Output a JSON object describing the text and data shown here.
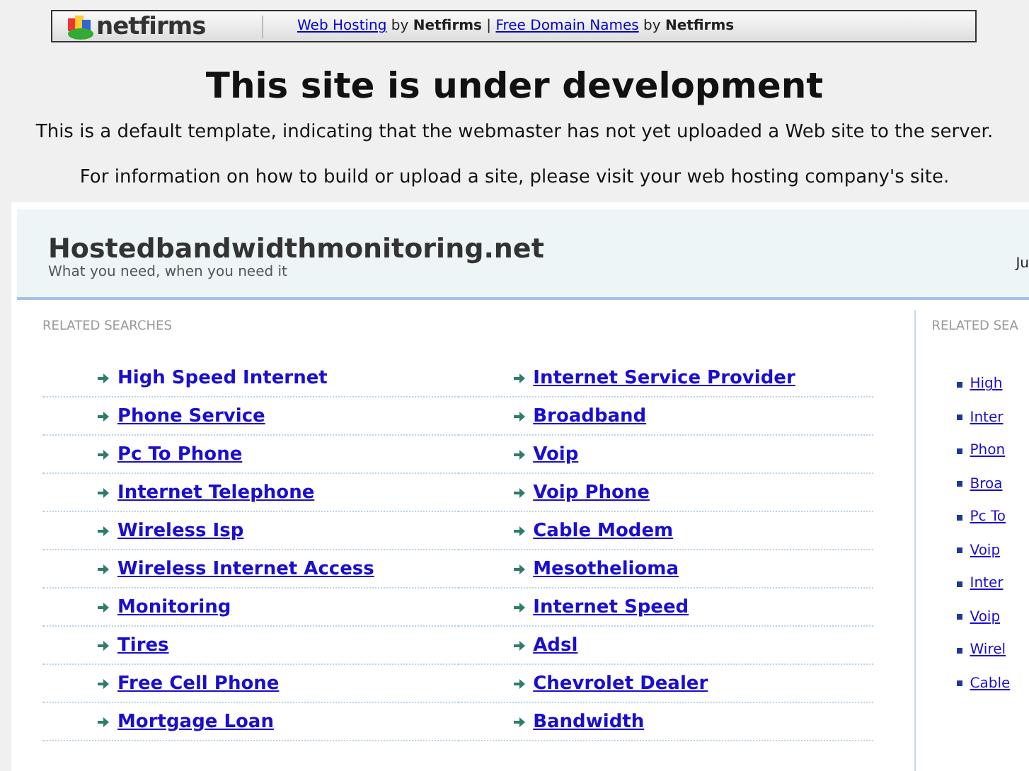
{
  "top_bar": {
    "logo": "netfirms",
    "links": [
      {
        "kind": "link",
        "text": "Web Hosting"
      },
      {
        "kind": "plain",
        "text": " by "
      },
      {
        "kind": "bold",
        "text": "Netfirms"
      },
      {
        "kind": "plain",
        "text": " | "
      },
      {
        "kind": "link",
        "text": "Free Domain Names"
      },
      {
        "kind": "plain",
        "text": " by "
      },
      {
        "kind": "bold",
        "text": "Netfirms"
      }
    ]
  },
  "heading": "This site is under development",
  "paragraphs": [
    "This is a default template, indicating that the webmaster has not yet uploaded a Web site to the server.",
    "For information on how to build or upload a site, please visit your web hosting company's site."
  ],
  "site": {
    "name": "Hostedbandwidthmonitoring.net",
    "tagline": "What you need, when you need it",
    "header_right": "Ju"
  },
  "main": {
    "heading": "RELATED SEARCHES",
    "links": [
      {
        "text": "High Speed Internet",
        "underlined": false
      },
      {
        "text": "Internet Service Provider",
        "underlined": true
      },
      {
        "text": "Phone Service",
        "underlined": true
      },
      {
        "text": "Broadband",
        "underlined": true
      },
      {
        "text": "Pc To Phone",
        "underlined": true
      },
      {
        "text": "Voip",
        "underlined": true
      },
      {
        "text": "Internet Telephone",
        "underlined": true
      },
      {
        "text": "Voip Phone",
        "underlined": true
      },
      {
        "text": "Wireless Isp",
        "underlined": true
      },
      {
        "text": "Cable Modem",
        "underlined": true
      },
      {
        "text": "Wireless Internet Access",
        "underlined": true
      },
      {
        "text": "Mesothelioma",
        "underlined": true
      },
      {
        "text": "Monitoring",
        "underlined": true
      },
      {
        "text": "Internet Speed",
        "underlined": true
      },
      {
        "text": "Tires",
        "underlined": true
      },
      {
        "text": "Adsl",
        "underlined": true
      },
      {
        "text": "Free Cell Phone",
        "underlined": true
      },
      {
        "text": "Chevrolet Dealer",
        "underlined": true
      },
      {
        "text": "Mortgage Loan",
        "underlined": true
      },
      {
        "text": "Bandwidth",
        "underlined": true
      }
    ]
  },
  "sidebar": {
    "heading": "RELATED SEA",
    "links": [
      "High",
      "Inter",
      "Phon",
      "Broa",
      "Pc To",
      "Voip",
      "Inter",
      "Voip",
      "Wirel",
      "Cable"
    ]
  }
}
